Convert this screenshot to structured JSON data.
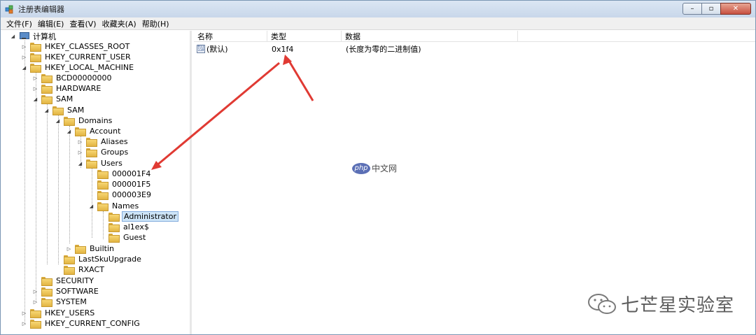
{
  "window": {
    "title": "注册表编辑器"
  },
  "window_buttons": {
    "minimize": "–",
    "maximize": "▫",
    "close": "✕"
  },
  "menu": [
    "文件(F)",
    "编辑(E)",
    "查看(V)",
    "收藏夹(A)",
    "帮助(H)"
  ],
  "tree": {
    "root": "计算机",
    "nodes": [
      {
        "label": "HKEY_CLASSES_ROOT"
      },
      {
        "label": "HKEY_CURRENT_USER"
      },
      {
        "label": "HKEY_LOCAL_MACHINE"
      },
      {
        "label": "BCD00000000"
      },
      {
        "label": "HARDWARE"
      },
      {
        "label": "SAM"
      },
      {
        "label": "SAM"
      },
      {
        "label": "Domains"
      },
      {
        "label": "Account"
      },
      {
        "label": "Aliases"
      },
      {
        "label": "Groups"
      },
      {
        "label": "Users"
      },
      {
        "label": "000001F4"
      },
      {
        "label": "000001F5"
      },
      {
        "label": "000003E9"
      },
      {
        "label": "Names"
      },
      {
        "label": "Administrator"
      },
      {
        "label": "al1ex$"
      },
      {
        "label": "Guest"
      },
      {
        "label": "Builtin"
      },
      {
        "label": "LastSkuUpgrade"
      },
      {
        "label": "RXACT"
      },
      {
        "label": "SECURITY"
      },
      {
        "label": "SOFTWARE"
      },
      {
        "label": "SYSTEM"
      },
      {
        "label": "HKEY_USERS"
      },
      {
        "label": "HKEY_CURRENT_CONFIG"
      }
    ],
    "selected": "Administrator"
  },
  "list": {
    "columns": [
      "名称",
      "类型",
      "数据"
    ],
    "rows": [
      {
        "name": "(默认)",
        "type": "0x1f4",
        "data": "(长度为零的二进制值)",
        "icon": "binary-value-icon"
      }
    ]
  },
  "watermark": {
    "badge": "php",
    "text": "中文网"
  },
  "credit": {
    "text": "七芒星实验室",
    "icon": "wechat-icon"
  },
  "colors": {
    "selection": "#cde4f7",
    "arrow": "#e03a33",
    "titlebar": "#c8d7ea"
  }
}
